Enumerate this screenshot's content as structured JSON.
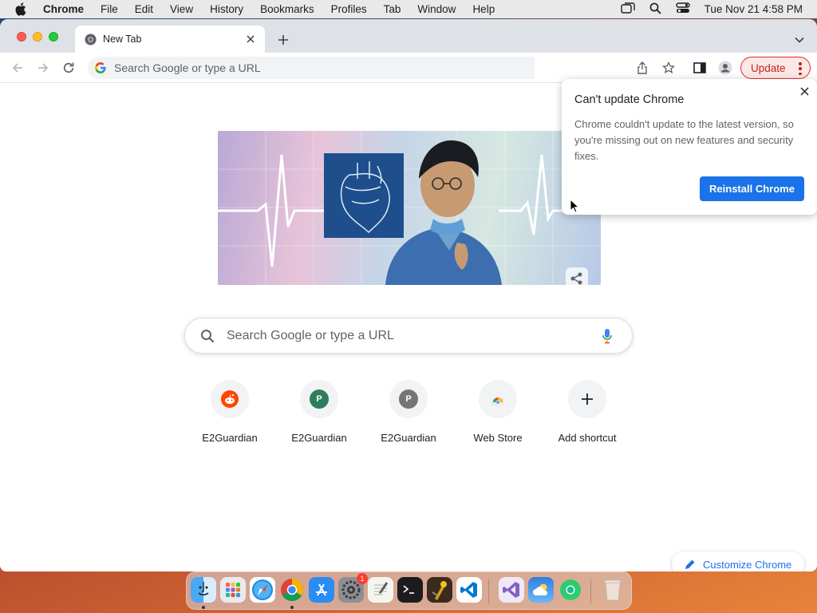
{
  "menubar": {
    "app_name": "Chrome",
    "items": [
      "File",
      "Edit",
      "View",
      "History",
      "Bookmarks",
      "Profiles",
      "Tab",
      "Window",
      "Help"
    ],
    "clock": "Tue Nov 21  4:58 PM",
    "status_icons": [
      "window-icon",
      "search-icon",
      "control-center-icon"
    ]
  },
  "browser": {
    "tab": {
      "title": "New Tab",
      "favicon": "chrome-icon"
    },
    "omnibox": {
      "placeholder": "Search Google or type a URL"
    },
    "update_button": {
      "label": "Update"
    }
  },
  "ntp": {
    "doodle": {
      "alt_icon": "share-icon"
    },
    "search": {
      "placeholder": "Search Google or type a URL"
    },
    "shortcuts": [
      {
        "label": "E2Guardian",
        "icon": "reddit-icon"
      },
      {
        "label": "E2Guardian",
        "icon": "letter-p",
        "letter": "P",
        "color": "#2e7d5b"
      },
      {
        "label": "E2Guardian",
        "icon": "letter-p",
        "letter": "P",
        "color": "#757575"
      },
      {
        "label": "Web Store",
        "icon": "web-store-icon"
      },
      {
        "label": "Add shortcut",
        "icon": "plus-icon"
      }
    ],
    "customize": {
      "label": "Customize Chrome"
    }
  },
  "popup": {
    "title": "Can't update Chrome",
    "body": "Chrome couldn't update to the latest version, so you're missing out on new features and security fixes.",
    "button": "Reinstall Chrome"
  },
  "dock": {
    "apps": [
      "Finder",
      "Launchpad",
      "Safari",
      "Chrome",
      "App Store",
      "System Settings",
      "TextEdit",
      "Terminal",
      "Instruments",
      "VS Code",
      "Visual Studio",
      "Weather",
      "Chrome Canary",
      "Trash"
    ],
    "settings_badge": "1"
  },
  "colors": {
    "accent": "#1a73e8",
    "update_red": "#c5221f"
  }
}
